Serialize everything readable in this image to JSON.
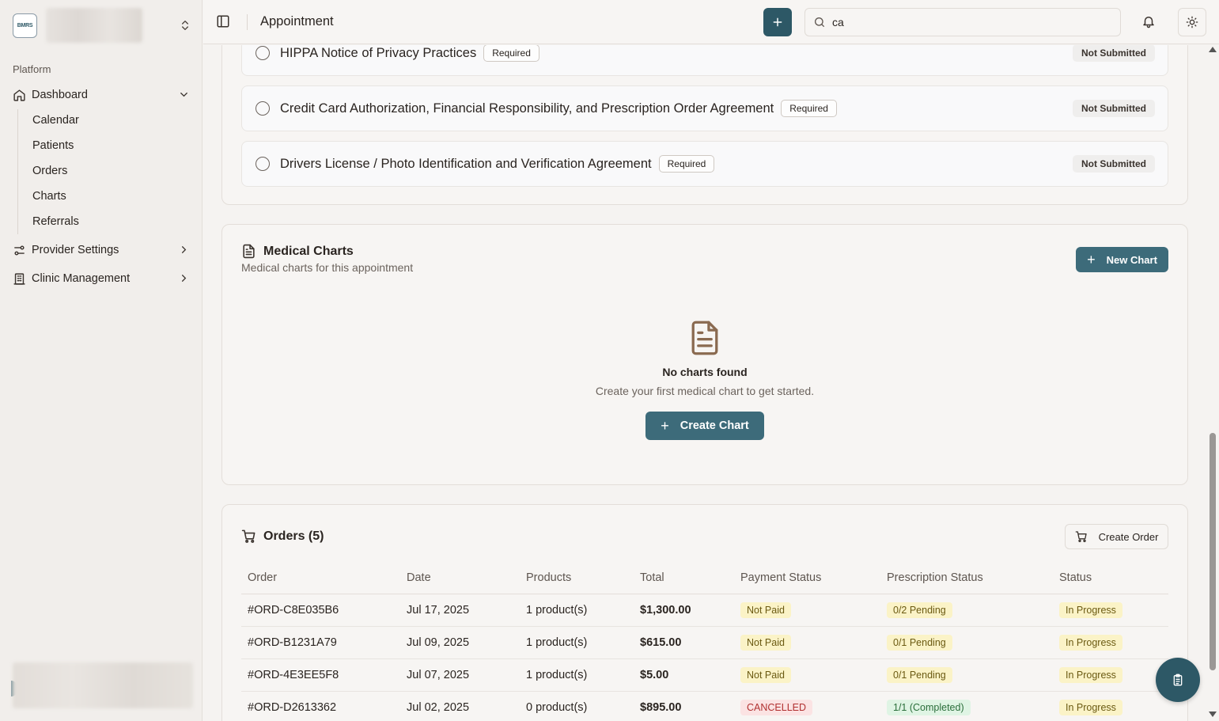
{
  "sidebar": {
    "logo_text": "BMRS",
    "section_label": "Platform",
    "dashboard": "Dashboard",
    "sub_items": [
      "Calendar",
      "Patients",
      "Orders",
      "Charts",
      "Referrals"
    ],
    "provider_settings": "Provider Settings",
    "clinic_management": "Clinic Management"
  },
  "header": {
    "title": "Appointment",
    "search_value": "ca"
  },
  "forms": [
    {
      "name": "HIPPA Notice of Privacy Practices",
      "badge": "Required",
      "status": "Not Submitted"
    },
    {
      "name": "Credit Card Authorization, Financial Responsibility, and Prescription Order Agreement",
      "badge": "Required",
      "status": "Not Submitted"
    },
    {
      "name": "Drivers License / Photo Identification and Verification Agreement",
      "badge": "Required",
      "status": "Not Submitted"
    }
  ],
  "charts": {
    "title": "Medical Charts",
    "subtitle": "Medical charts for this appointment",
    "new_button": "New Chart",
    "empty_title": "No charts found",
    "empty_subtitle": "Create your first medical chart to get started.",
    "create_button": "Create Chart"
  },
  "orders": {
    "title": "Orders (5)",
    "create_button": "Create Order",
    "columns": [
      "Order",
      "Date",
      "Products",
      "Total",
      "Payment Status",
      "Prescription Status",
      "Status"
    ],
    "rows": [
      {
        "id": "#ORD-C8E035B6",
        "date": "Jul 17, 2025",
        "products": "1 product(s)",
        "total": "$1,300.00",
        "payment": "Not Paid",
        "prescription": "0/2 Pending",
        "status": "In Progress"
      },
      {
        "id": "#ORD-B1231A79",
        "date": "Jul 09, 2025",
        "products": "1 product(s)",
        "total": "$615.00",
        "payment": "Not Paid",
        "prescription": "0/1 Pending",
        "status": "In Progress"
      },
      {
        "id": "#ORD-4E3EE5F8",
        "date": "Jul 07, 2025",
        "products": "1 product(s)",
        "total": "$5.00",
        "payment": "Not Paid",
        "prescription": "0/1 Pending",
        "status": "In Progress"
      },
      {
        "id": "#ORD-D2613362",
        "date": "Jul 02, 2025",
        "products": "0 product(s)",
        "total": "$895.00",
        "payment": "CANCELLED",
        "prescription": "1/1 (Completed)",
        "status": "In Progress"
      }
    ]
  },
  "colors": {
    "primary": "#2d5866",
    "badge_yellow": "#fbf3c7",
    "badge_red": "#fbe3e3",
    "badge_green": "#dff4e4"
  }
}
